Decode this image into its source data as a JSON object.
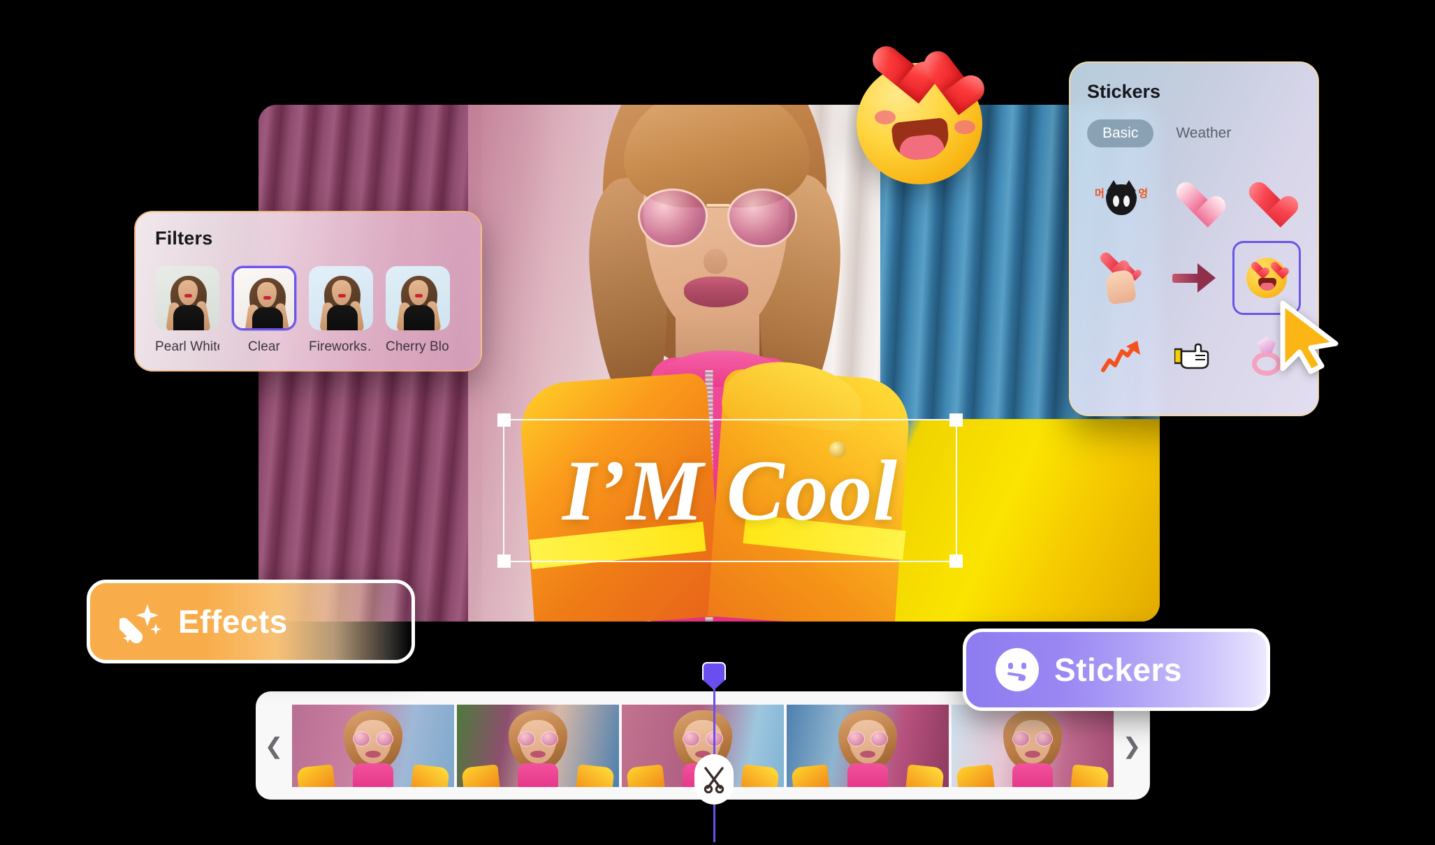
{
  "filters_panel": {
    "title": "Filters",
    "items": [
      {
        "label": "Pearl White",
        "selected": false,
        "tint": "#e6eae6"
      },
      {
        "label": "Clear",
        "selected": true,
        "tint": "#f7f4f2"
      },
      {
        "label": "Fireworks…",
        "selected": false,
        "tint": "#dceaf6"
      },
      {
        "label": "Cherry Blo…",
        "selected": false,
        "tint": "#dbeaf3"
      }
    ],
    "selected_border_color": "#6a56e8",
    "border_color": "#f6b26e"
  },
  "stickers_panel": {
    "title": "Stickers",
    "tabs": [
      {
        "label": "Basic",
        "active": true
      },
      {
        "label": "Weather",
        "active": false
      }
    ],
    "active_tab_bg": "#7e96a8",
    "border_color": "#f8d8a2",
    "stickers": [
      {
        "name": "black-cat-sticker",
        "selected": false
      },
      {
        "name": "heart-cake-sticker",
        "selected": false
      },
      {
        "name": "red-heart-sticker",
        "selected": false
      },
      {
        "name": "finger-heart-sticker",
        "selected": false
      },
      {
        "name": "arrow-sticker",
        "selected": false
      },
      {
        "name": "heart-eyes-emoji-sticker",
        "selected": true
      },
      {
        "name": "chart-increasing-sticker",
        "selected": false
      },
      {
        "name": "pointing-hand-sticker",
        "selected": false
      },
      {
        "name": "ring-sticker",
        "selected": false
      }
    ],
    "selected_border_color": "#6a56e8"
  },
  "canvas": {
    "overlay_text": "I’M Cool",
    "overlay_text_color": "#ffffff"
  },
  "effects_button": {
    "label": "Effects",
    "icon": "magic-wand-icon",
    "color": "#f9ad4a"
  },
  "stickers_button": {
    "label": "Stickers",
    "icon": "smiley-face-icon",
    "color": "#8d7cf0"
  },
  "timeline": {
    "prev_icon": "chevron-left-icon",
    "next_icon": "chevron-right-icon",
    "split_icon": "scissors-icon",
    "playhead_color": "#6a4ef0",
    "clips": [
      {
        "name": "clip-1"
      },
      {
        "name": "clip-2"
      },
      {
        "name": "clip-3"
      },
      {
        "name": "clip-4"
      },
      {
        "name": "clip-5"
      }
    ]
  },
  "floating_sticker": {
    "name": "heart-eyes-emoji"
  },
  "cursor": {
    "name": "arrow-cursor",
    "color": "#fbb615"
  }
}
